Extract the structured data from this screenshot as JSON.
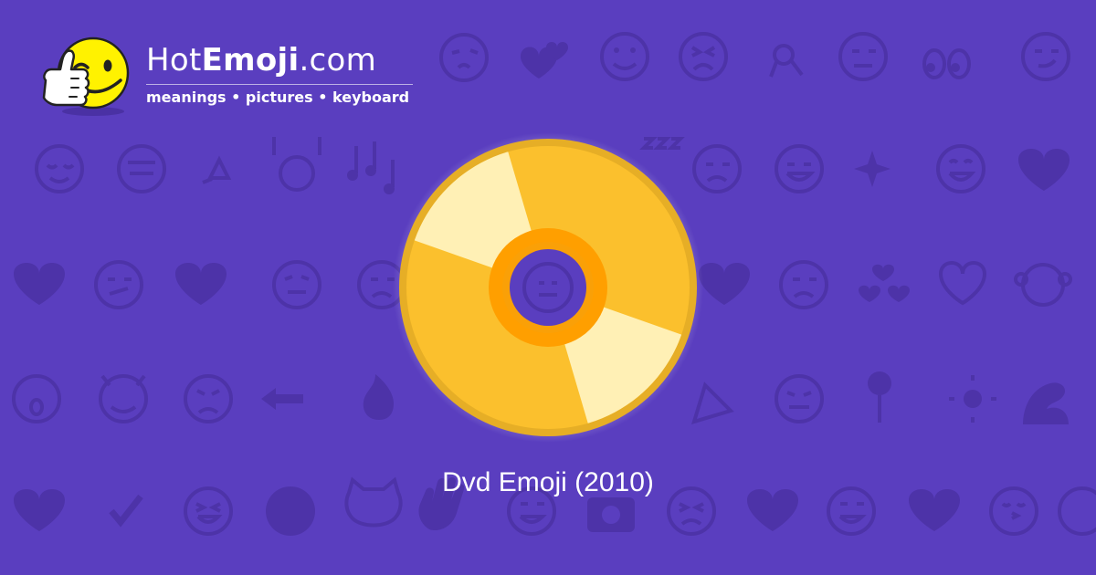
{
  "brand": {
    "name_prefix": "Hot",
    "name_bold": "Emoji",
    "name_suffix": ".com",
    "tagline": "meanings • pictures • keyboard"
  },
  "emoji": {
    "caption": "Dvd Emoji (2010)",
    "icon": "dvd-disc-icon"
  },
  "colors": {
    "background": "#5a3ebf",
    "pattern": "#4d33a8",
    "disc_gold": "#fbc02d",
    "disc_rim": "#e6ae26",
    "disc_highlight": "#fff0b5",
    "disc_hub": "#ff9f00",
    "logo_face": "#fff200"
  },
  "background_pattern_icons": [
    "smiling-face-icon",
    "winking-kiss-icon",
    "two-hearts-icon",
    "slightly-smiling-icon",
    "weary-face-icon",
    "ok-hand-icon",
    "neutral-face-icon",
    "eyes-icon",
    "smirking-face-icon",
    "relieved-face-icon",
    "recycle-icon",
    "raising-hands-icon",
    "music-notes-icon",
    "zzz-icon",
    "sad-face-icon",
    "grinning-face-icon",
    "sparkles-icon",
    "striped-heart-icon",
    "broken-heart-icon",
    "confused-face-icon",
    "tongue-face-icon",
    "frowning-face-icon",
    "heart-arrow-icon",
    "revolving-hearts-icon",
    "heart-icon",
    "monkey-icon",
    "screaming-face-icon",
    "smiling-devil-icon",
    "angry-face-icon",
    "left-arrow-icon",
    "fire-icon",
    "party-popper-icon",
    "rose-icon",
    "sun-icon",
    "flexed-biceps-icon",
    "check-mark-icon",
    "laughing-face-icon",
    "heart-eyes-cat-icon",
    "waving-hand-icon",
    "camera-icon",
    "beating-heart-icon",
    "kissing-face-icon"
  ]
}
